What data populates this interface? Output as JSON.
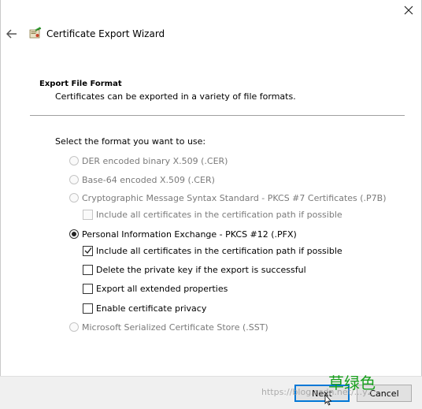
{
  "window": {
    "title": "Certificate Export Wizard",
    "close_icon": "close-icon",
    "back_icon": "back-arrow-icon",
    "wizard_icon": "certificate-wizard-icon"
  },
  "section": {
    "heading": "Export File Format",
    "description": "Certificates can be exported in a variety of file formats."
  },
  "prompt": "Select the format you want to use:",
  "options": {
    "der": {
      "label": "DER encoded binary X.509 (.CER)",
      "selected": false,
      "enabled": false
    },
    "base64": {
      "label": "Base-64 encoded X.509 (.CER)",
      "selected": false,
      "enabled": false
    },
    "pkcs7": {
      "label": "Cryptographic Message Syntax Standard - PKCS #7 Certificates (.P7B)",
      "selected": false,
      "enabled": false
    },
    "pkcs7_include_all": {
      "label": "Include all certificates in the certification path if possible",
      "checked": false,
      "enabled": false
    },
    "pfx": {
      "label": "Personal Information Exchange - PKCS #12 (.PFX)",
      "selected": true,
      "enabled": true
    },
    "pfx_include_all": {
      "label": "Include all certificates in the certification path if possible",
      "checked": true,
      "enabled": true
    },
    "pfx_delete_key": {
      "label": "Delete the private key if the export is successful",
      "checked": false,
      "enabled": true
    },
    "pfx_export_ext": {
      "label": "Export all extended properties",
      "checked": false,
      "enabled": true
    },
    "pfx_privacy": {
      "label": "Enable certificate privacy",
      "checked": false,
      "enabled": true
    },
    "sst": {
      "label": "Microsoft Serialized Certificate Store (.SST)",
      "selected": false,
      "enabled": false
    }
  },
  "footer": {
    "next_label": "Next",
    "cancel_label": "Cancel"
  },
  "watermark": {
    "url": "https://blog.csdn.net/...y2",
    "text": "草绿色"
  },
  "colors": {
    "accent": "#0078d7",
    "disabled_text": "#7a7a7a",
    "watermark_green": "#19a11e"
  }
}
